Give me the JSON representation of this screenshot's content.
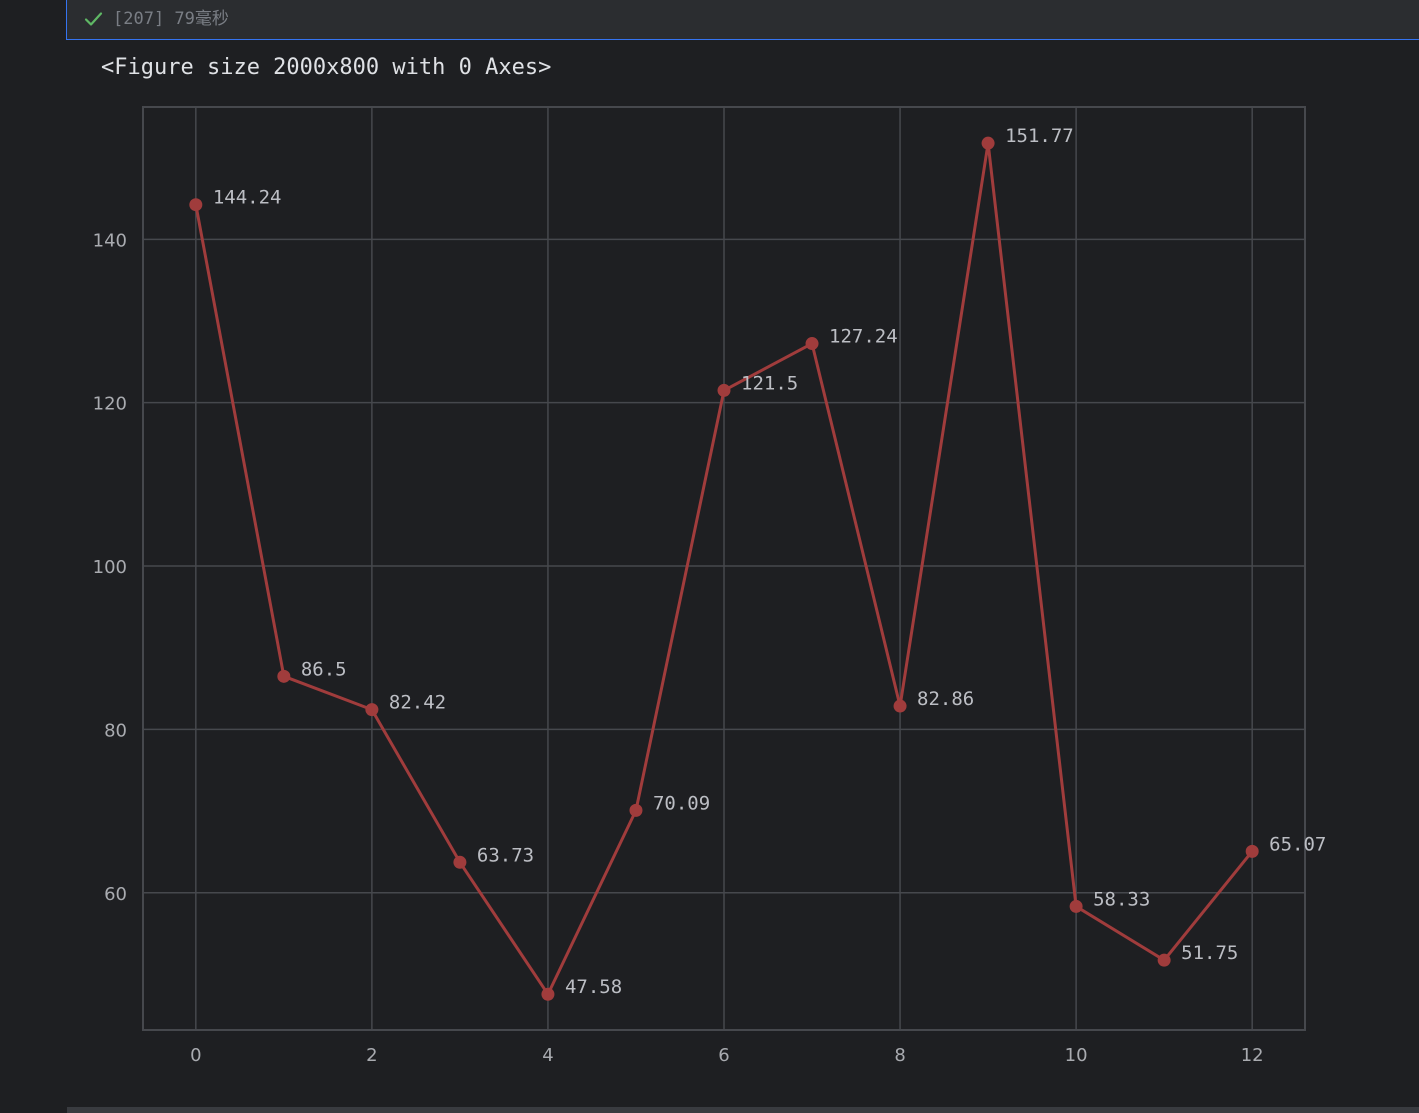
{
  "cell": {
    "status_icon": "check-icon",
    "status_color": "#5fb865",
    "exec_label": "[207] 79毫秒"
  },
  "output": {
    "figure_text": "<Figure size 2000x800 with 0 Axes>"
  },
  "chart_data": {
    "type": "line",
    "title": "",
    "xlabel": "",
    "ylabel": "",
    "x": [
      0,
      1,
      2,
      3,
      4,
      5,
      6,
      7,
      8,
      9,
      10,
      11,
      12
    ],
    "values": [
      144.24,
      86.5,
      82.42,
      63.73,
      47.58,
      70.09,
      121.5,
      127.24,
      82.86,
      151.77,
      58.33,
      51.75,
      65.07
    ],
    "data_labels": [
      "144.24",
      "86.5",
      "82.42",
      "63.73",
      "47.58",
      "70.09",
      "121.5",
      "127.24",
      "82.86",
      "151.77",
      "58.33",
      "51.75",
      "65.07"
    ],
    "xticks": [
      0,
      2,
      4,
      6,
      8,
      10,
      12
    ],
    "yticks": [
      60,
      80,
      100,
      120,
      140
    ],
    "xlim": [
      -0.6,
      12.6
    ],
    "ylim": [
      43.2,
      156.2
    ],
    "grid": true,
    "line_color": "#a03c3c",
    "grid_color": "#46484d",
    "background": "#1e1f22"
  }
}
